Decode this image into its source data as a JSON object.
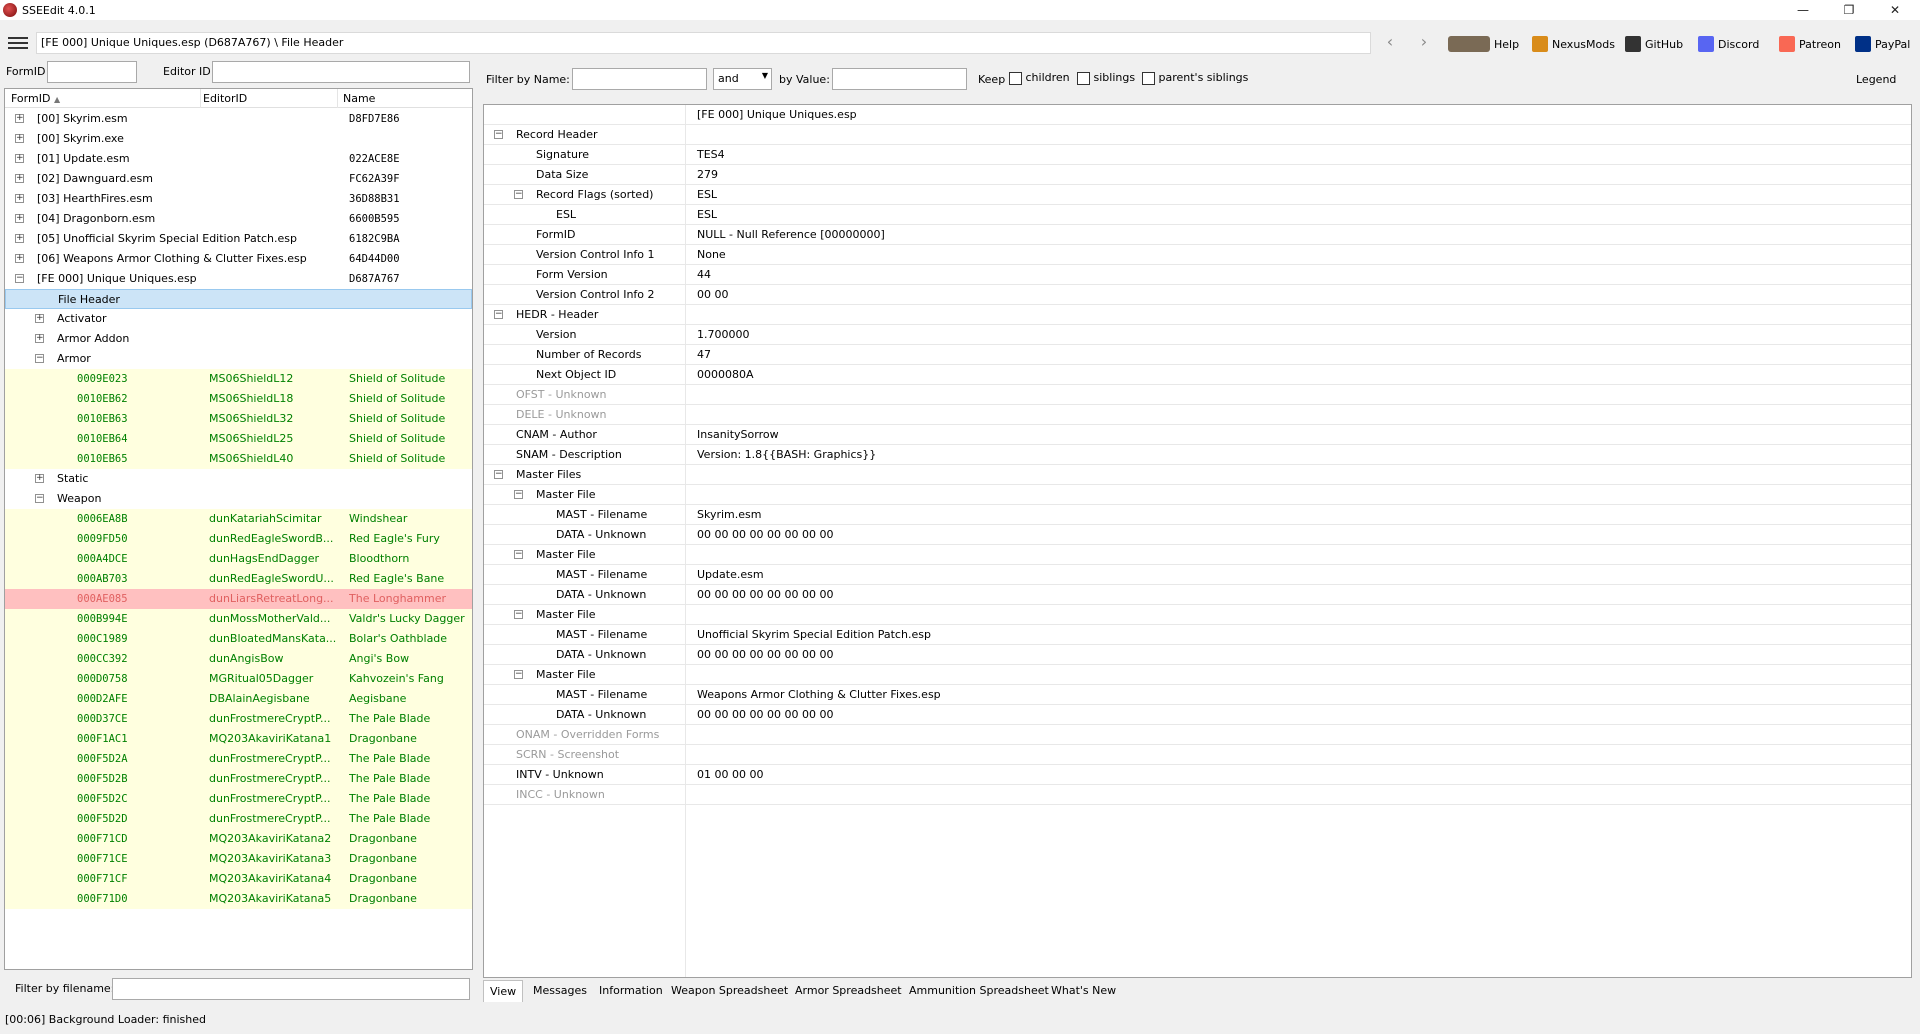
{
  "window": {
    "title": "SSEEdit 4.0.1",
    "minimize": "—",
    "restore": "❐",
    "close": "✕"
  },
  "toolbar": {
    "path": "[FE 000] Unique Uniques.esp (D687A767) \\ File Header",
    "back": "‹",
    "forward": "›",
    "buttons": [
      {
        "label": "Help",
        "icon": "book-icon",
        "color": "#7a6a55"
      },
      {
        "label": "NexusMods",
        "icon": "nexusmods-icon",
        "color": "#d98c1a"
      },
      {
        "label": "GitHub",
        "icon": "github-icon",
        "color": "#333333"
      },
      {
        "label": "Discord",
        "icon": "discord-icon",
        "color": "#5865f2"
      },
      {
        "label": "Patreon",
        "icon": "patreon-icon",
        "color": "#f96854"
      },
      {
        "label": "PayPal",
        "icon": "paypal-icon",
        "color": "#003087"
      }
    ]
  },
  "left_filter": {
    "formid_label": "FormID",
    "formid_value": "",
    "editorid_label": "Editor ID",
    "editorid_value": ""
  },
  "left_tree": {
    "headers": [
      "FormID",
      "EditorID",
      "Name"
    ],
    "sort_glyph": "▲",
    "files": [
      {
        "label": "[00] Skyrim.esm",
        "hash": "D8FD7E86"
      },
      {
        "label": "[00] Skyrim.exe",
        "hash": ""
      },
      {
        "label": "[01] Update.esm",
        "hash": "022ACE8E"
      },
      {
        "label": "[02] Dawnguard.esm",
        "hash": "FC62A39F"
      },
      {
        "label": "[03] HearthFires.esm",
        "hash": "36D88B31"
      },
      {
        "label": "[04] Dragonborn.esm",
        "hash": "6600B595"
      },
      {
        "label": "[05] Unofficial Skyrim Special Edition Patch.esp",
        "hash": "6182C9BA"
      },
      {
        "label": "[06] Weapons Armor Clothing & Clutter Fixes.esp",
        "hash": "64D44D00"
      },
      {
        "label": "[FE 000] Unique Uniques.esp",
        "hash": "D687A767"
      }
    ],
    "file_header": "File Header",
    "groups": {
      "activator": "Activator",
      "armor_addon": "Armor Addon",
      "armor": "Armor",
      "static": "Static",
      "weapon": "Weapon"
    },
    "armor_records": [
      {
        "formid": "0009E023",
        "editorid": "MS06ShieldL12",
        "name": "Shield of Solitude"
      },
      {
        "formid": "0010EB62",
        "editorid": "MS06ShieldL18",
        "name": "Shield of Solitude"
      },
      {
        "formid": "0010EB63",
        "editorid": "MS06ShieldL32",
        "name": "Shield of Solitude"
      },
      {
        "formid": "0010EB64",
        "editorid": "MS06ShieldL25",
        "name": "Shield of Solitude"
      },
      {
        "formid": "0010EB65",
        "editorid": "MS06ShieldL40",
        "name": "Shield of Solitude"
      }
    ],
    "weapon_records": [
      {
        "formid": "0006EA8B",
        "editorid": "dunKatariahScimitar",
        "name": "Windshear"
      },
      {
        "formid": "0009FD50",
        "editorid": "dunRedEagleSwordB...",
        "name": "Red Eagle's Fury"
      },
      {
        "formid": "000A4DCE",
        "editorid": "dunHagsEndDagger",
        "name": "Bloodthorn"
      },
      {
        "formid": "000AB703",
        "editorid": "dunRedEagleSwordU...",
        "name": "Red Eagle's Bane"
      },
      {
        "formid": "000AE085",
        "editorid": "dunLiarsRetreatLong...",
        "name": "The Longhammer"
      },
      {
        "formid": "000B994E",
        "editorid": "dunMossMotherVald...",
        "name": "Valdr's Lucky Dagger"
      },
      {
        "formid": "000C1989",
        "editorid": "dunBloatedMansKata...",
        "name": "Bolar's Oathblade"
      },
      {
        "formid": "000CC392",
        "editorid": "dunAngisBow",
        "name": "Angi's Bow"
      },
      {
        "formid": "000D0758",
        "editorid": "MGRitual05Dagger",
        "name": "Kahvozein's Fang"
      },
      {
        "formid": "000D2AFE",
        "editorid": "DBAlainAegisbane",
        "name": "Aegisbane"
      },
      {
        "formid": "000D37CE",
        "editorid": "dunFrostmereCryptP...",
        "name": "The Pale Blade"
      },
      {
        "formid": "000F1AC1",
        "editorid": "MQ203AkaviriKatana1",
        "name": "Dragonbane"
      },
      {
        "formid": "000F5D2A",
        "editorid": "dunFrostmereCryptP...",
        "name": "The Pale Blade"
      },
      {
        "formid": "000F5D2B",
        "editorid": "dunFrostmereCryptP...",
        "name": "The Pale Blade"
      },
      {
        "formid": "000F5D2C",
        "editorid": "dunFrostmereCryptP...",
        "name": "The Pale Blade"
      },
      {
        "formid": "000F5D2D",
        "editorid": "dunFrostmereCryptP...",
        "name": "The Pale Blade"
      },
      {
        "formid": "000F71CD",
        "editorid": "MQ203AkaviriKatana2",
        "name": "Dragonbane"
      },
      {
        "formid": "000F71CE",
        "editorid": "MQ203AkaviriKatana3",
        "name": "Dragonbane"
      },
      {
        "formid": "000F71CF",
        "editorid": "MQ203AkaviriKatana4",
        "name": "Dragonbane"
      },
      {
        "formid": "000F71D0",
        "editorid": "MQ203AkaviriKatana5",
        "name": "Dragonbane"
      }
    ],
    "highlighted_weapon_index": 4
  },
  "left_bottom": {
    "filter_label": "Filter by filename:",
    "filter_value": ""
  },
  "right_filter": {
    "name_label": "Filter by Name:",
    "name_value": "",
    "op_value": "and",
    "value_label": "by Value:",
    "value_value": "",
    "keep_label": "Keep",
    "children": "children",
    "siblings": "siblings",
    "parents": "parent's siblings",
    "legend": "Legend"
  },
  "record": {
    "file_title": "[FE 000] Unique Uniques.esp",
    "rows": [
      {
        "k": "Record Header",
        "v": "",
        "exp": "−"
      },
      {
        "k": "Signature",
        "v": "TES4"
      },
      {
        "k": "Data Size",
        "v": "279"
      },
      {
        "k": "Record Flags (sorted)",
        "v": "ESL",
        "exp": "−"
      },
      {
        "k": "ESL",
        "v": "ESL"
      },
      {
        "k": "FormID",
        "v": "NULL - Null Reference [00000000]"
      },
      {
        "k": "Version Control Info 1",
        "v": "None"
      },
      {
        "k": "Form Version",
        "v": "44"
      },
      {
        "k": "Version Control Info 2",
        "v": "00 00"
      },
      {
        "k": "HEDR - Header",
        "v": "",
        "exp": "−"
      },
      {
        "k": "Version",
        "v": "1.700000"
      },
      {
        "k": "Number of Records",
        "v": "47"
      },
      {
        "k": "Next Object ID",
        "v": "0000080A"
      },
      {
        "k": "OFST - Unknown",
        "v": "",
        "gray": true
      },
      {
        "k": "DELE - Unknown",
        "v": "",
        "gray": true
      },
      {
        "k": "CNAM - Author",
        "v": "InsanitySorrow"
      },
      {
        "k": "SNAM - Description",
        "v": "Version: 1.8{{BASH: Graphics}}"
      },
      {
        "k": "Master Files",
        "v": "",
        "exp": "−"
      },
      {
        "k": "Master File",
        "v": "",
        "exp": "−"
      },
      {
        "k": "MAST - Filename",
        "v": "Skyrim.esm"
      },
      {
        "k": "DATA - Unknown",
        "v": "00 00 00 00 00 00 00 00"
      },
      {
        "k": "Master File",
        "v": "",
        "exp": "−"
      },
      {
        "k": "MAST - Filename",
        "v": "Update.esm"
      },
      {
        "k": "DATA - Unknown",
        "v": "00 00 00 00 00 00 00 00"
      },
      {
        "k": "Master File",
        "v": "",
        "exp": "−"
      },
      {
        "k": "MAST - Filename",
        "v": "Unofficial Skyrim Special Edition Patch.esp"
      },
      {
        "k": "DATA - Unknown",
        "v": "00 00 00 00 00 00 00 00"
      },
      {
        "k": "Master File",
        "v": "",
        "exp": "−"
      },
      {
        "k": "MAST - Filename",
        "v": "Weapons Armor Clothing & Clutter Fixes.esp"
      },
      {
        "k": "DATA - Unknown",
        "v": "00 00 00 00 00 00 00 00"
      },
      {
        "k": "ONAM - Overridden Forms",
        "v": "",
        "gray": true
      },
      {
        "k": "SCRN - Screenshot",
        "v": "",
        "gray": true
      },
      {
        "k": "INTV - Unknown",
        "v": "01 00 00 00"
      },
      {
        "k": "INCC - Unknown",
        "v": "",
        "gray": true
      }
    ]
  },
  "tabs": [
    "View",
    "Messages",
    "Information",
    "Weapon Spreadsheet",
    "Armor Spreadsheet",
    "Ammunition Spreadsheet",
    "What's New"
  ],
  "status": "[00:06] Background Loader: finished"
}
